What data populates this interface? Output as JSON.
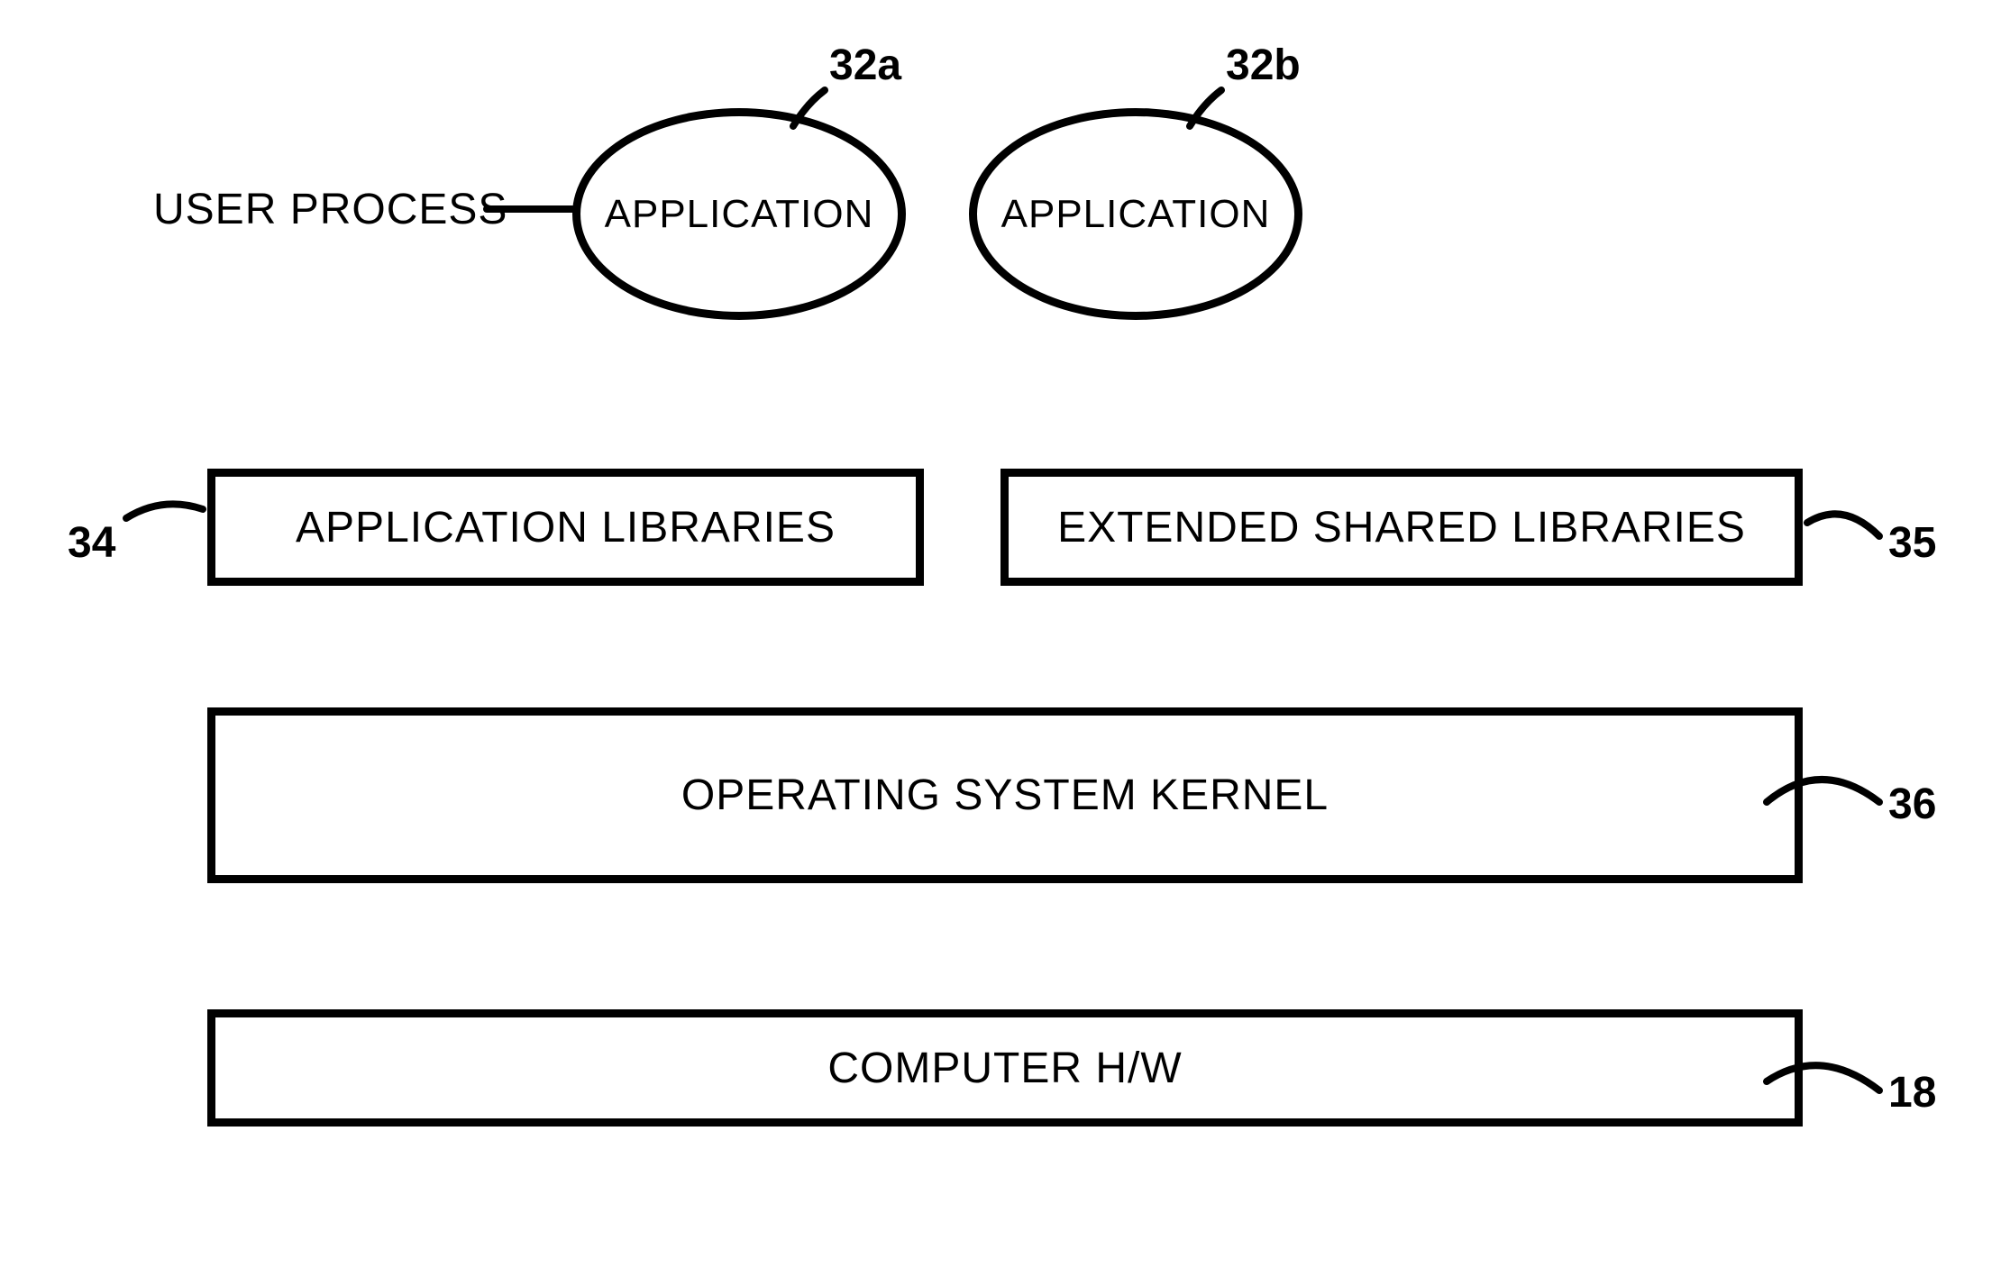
{
  "userProcessLabel": "USER PROCESS",
  "ellipses": {
    "app1": {
      "text": "APPLICATION",
      "ref": "32a"
    },
    "app2": {
      "text": "APPLICATION",
      "ref": "32b"
    }
  },
  "boxes": {
    "appLibs": {
      "text": "APPLICATION LIBRARIES",
      "ref": "34"
    },
    "extLibs": {
      "text": "EXTENDED SHARED LIBRARIES",
      "ref": "35"
    },
    "kernel": {
      "text": "OPERATING SYSTEM KERNEL",
      "ref": "36"
    },
    "hw": {
      "text": "COMPUTER H/W",
      "ref": "18"
    }
  }
}
